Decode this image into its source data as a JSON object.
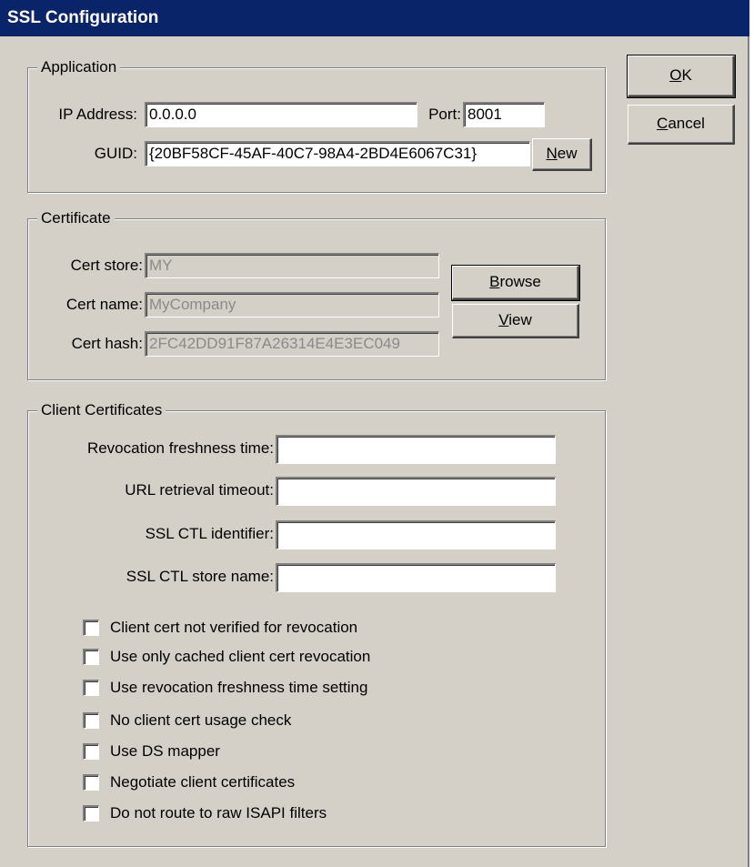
{
  "window": {
    "title": "SSL Configuration"
  },
  "buttons": {
    "ok": {
      "pre": "",
      "accel": "O",
      "post": "K"
    },
    "cancel": {
      "pre": "",
      "accel": "C",
      "post": "ancel"
    },
    "new": {
      "pre": "",
      "accel": "N",
      "post": "ew"
    },
    "browse": {
      "pre": "",
      "accel": "B",
      "post": "rowse"
    },
    "view": {
      "pre": "",
      "accel": "V",
      "post": "iew"
    }
  },
  "application": {
    "legend": "Application",
    "ip_label": "IP Address:",
    "ip_value": "0.0.0.0",
    "port_label": "Port:",
    "port_value": "8001",
    "guid_label": "GUID:",
    "guid_value": "{20BF58CF-45AF-40C7-98A4-2BD4E6067C31}"
  },
  "certificate": {
    "legend": "Certificate",
    "store_label": "Cert store:",
    "store_value": "MY",
    "name_label": "Cert name:",
    "name_value": "MyCompany",
    "hash_label": "Cert hash:",
    "hash_value": "2FC42DD91F87A26314E4E3EC049"
  },
  "client": {
    "legend": "Client Certificates",
    "fields": [
      {
        "label": "Revocation freshness time:",
        "value": ""
      },
      {
        "label": "URL retrieval timeout:",
        "value": ""
      },
      {
        "label": "SSL CTL identifier:",
        "value": ""
      },
      {
        "label": "SSL CTL store name:",
        "value": ""
      }
    ],
    "checkboxes": [
      {
        "label": "Client cert not verified for revocation",
        "checked": false
      },
      {
        "label": "Use only cached client cert revocation",
        "checked": false
      },
      {
        "label": "Use revocation freshness time setting",
        "checked": false
      },
      {
        "label": "No client cert usage check",
        "checked": false
      },
      {
        "label": "Use DS mapper",
        "checked": false
      },
      {
        "label": "Negotiate client certificates",
        "checked": false
      },
      {
        "label": "Do not route to raw ISAPI filters",
        "checked": false
      }
    ]
  }
}
